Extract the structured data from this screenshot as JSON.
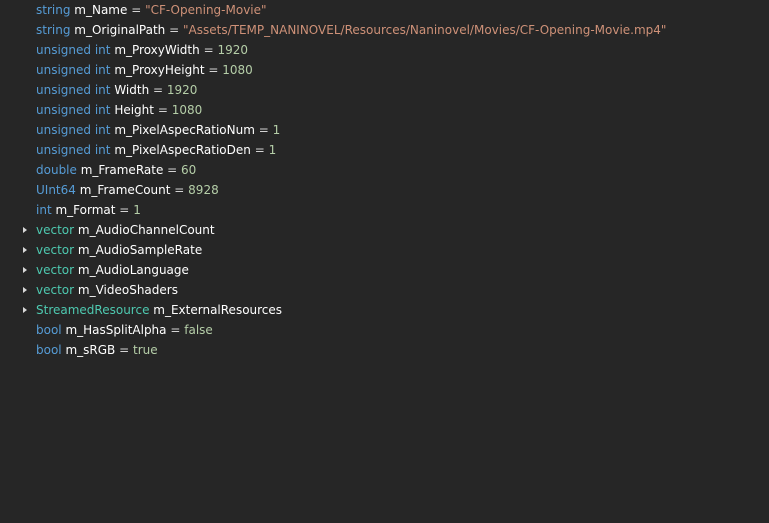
{
  "rows": [
    {
      "type": "string",
      "name": "m_Name",
      "op": "=",
      "value": "\"CF-Opening-Movie\""
    },
    {
      "type": "string",
      "name": "m_OriginalPath",
      "op": "=",
      "value": "\"Assets/TEMP_NANINOVEL/Resources/Naninovel/Movies/CF-Opening-Movie.mp4\""
    },
    {
      "type": "unsigned int",
      "name": "m_ProxyWidth",
      "op": "=",
      "value": "1920"
    },
    {
      "type": "unsigned int",
      "name": "m_ProxyHeight",
      "op": "=",
      "value": "1080"
    },
    {
      "type": "unsigned int",
      "name": "Width",
      "op": "=",
      "value": "1920"
    },
    {
      "type": "unsigned int",
      "name": "Height",
      "op": "=",
      "value": "1080"
    },
    {
      "type": "unsigned int",
      "name": "m_PixelAspecRatioNum",
      "op": "=",
      "value": "1"
    },
    {
      "type": "unsigned int",
      "name": "m_PixelAspecRatioDen",
      "op": "=",
      "value": "1"
    },
    {
      "type": "double",
      "name": "m_FrameRate",
      "op": "=",
      "value": "60"
    },
    {
      "type": "UInt64",
      "name": "m_FrameCount",
      "op": "=",
      "value": "8928"
    },
    {
      "type": "int",
      "name": "m_Format",
      "op": "=",
      "value": "1"
    },
    {
      "type": "vector",
      "name": "m_AudioChannelCount"
    },
    {
      "type": "vector",
      "name": "m_AudioSampleRate"
    },
    {
      "type": "vector",
      "name": "m_AudioLanguage"
    },
    {
      "type": "vector",
      "name": "m_VideoShaders"
    },
    {
      "type": "StreamedResource",
      "name": "m_ExternalResources"
    },
    {
      "type": "bool",
      "name": "m_HasSplitAlpha",
      "op": "=",
      "value": "false"
    },
    {
      "type": "bool",
      "name": "m_sRGB",
      "op": "=",
      "value": "true"
    }
  ],
  "colors": {
    "background": "#262626",
    "keyword": "#569cd6",
    "class": "#4ec9b0",
    "string": "#ce9178",
    "number": "#b5cea8",
    "field": "#ffffff",
    "expander": "#d8d8d8"
  },
  "icons": {
    "expander": "triangle-right-icon"
  }
}
